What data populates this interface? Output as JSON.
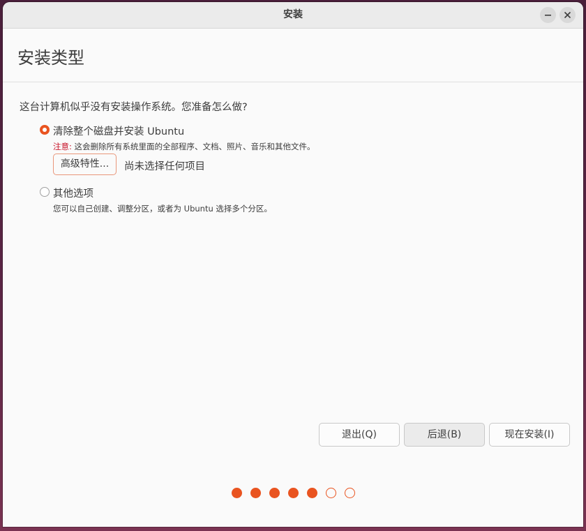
{
  "window": {
    "title": "安装"
  },
  "page": {
    "title": "安装类型",
    "question": "这台计算机似乎没有安装操作系统。您准备怎么做?"
  },
  "options": [
    {
      "label": "清除整个磁盘并安装 Ubuntu",
      "selected": true,
      "warning_prefix": "注意:",
      "warning_text": " 这会删除所有系统里面的全部程序、文档、照片、音乐和其他文件。",
      "advanced_button": "高级特性...",
      "advanced_status": "尚未选择任何项目"
    },
    {
      "label": "其他选项",
      "selected": false,
      "description": "您可以自己创建、调整分区，或者为 Ubuntu 选择多个分区。"
    }
  ],
  "buttons": {
    "quit": "退出(Q)",
    "back": "后退(B)",
    "install": "现在安装(I)"
  },
  "progress": {
    "total_steps": 7,
    "completed_steps": 5
  },
  "colors": {
    "accent": "#e95420",
    "warning": "#c7162b"
  },
  "icons": {
    "minimize": "minimize-icon",
    "close": "close-icon"
  }
}
